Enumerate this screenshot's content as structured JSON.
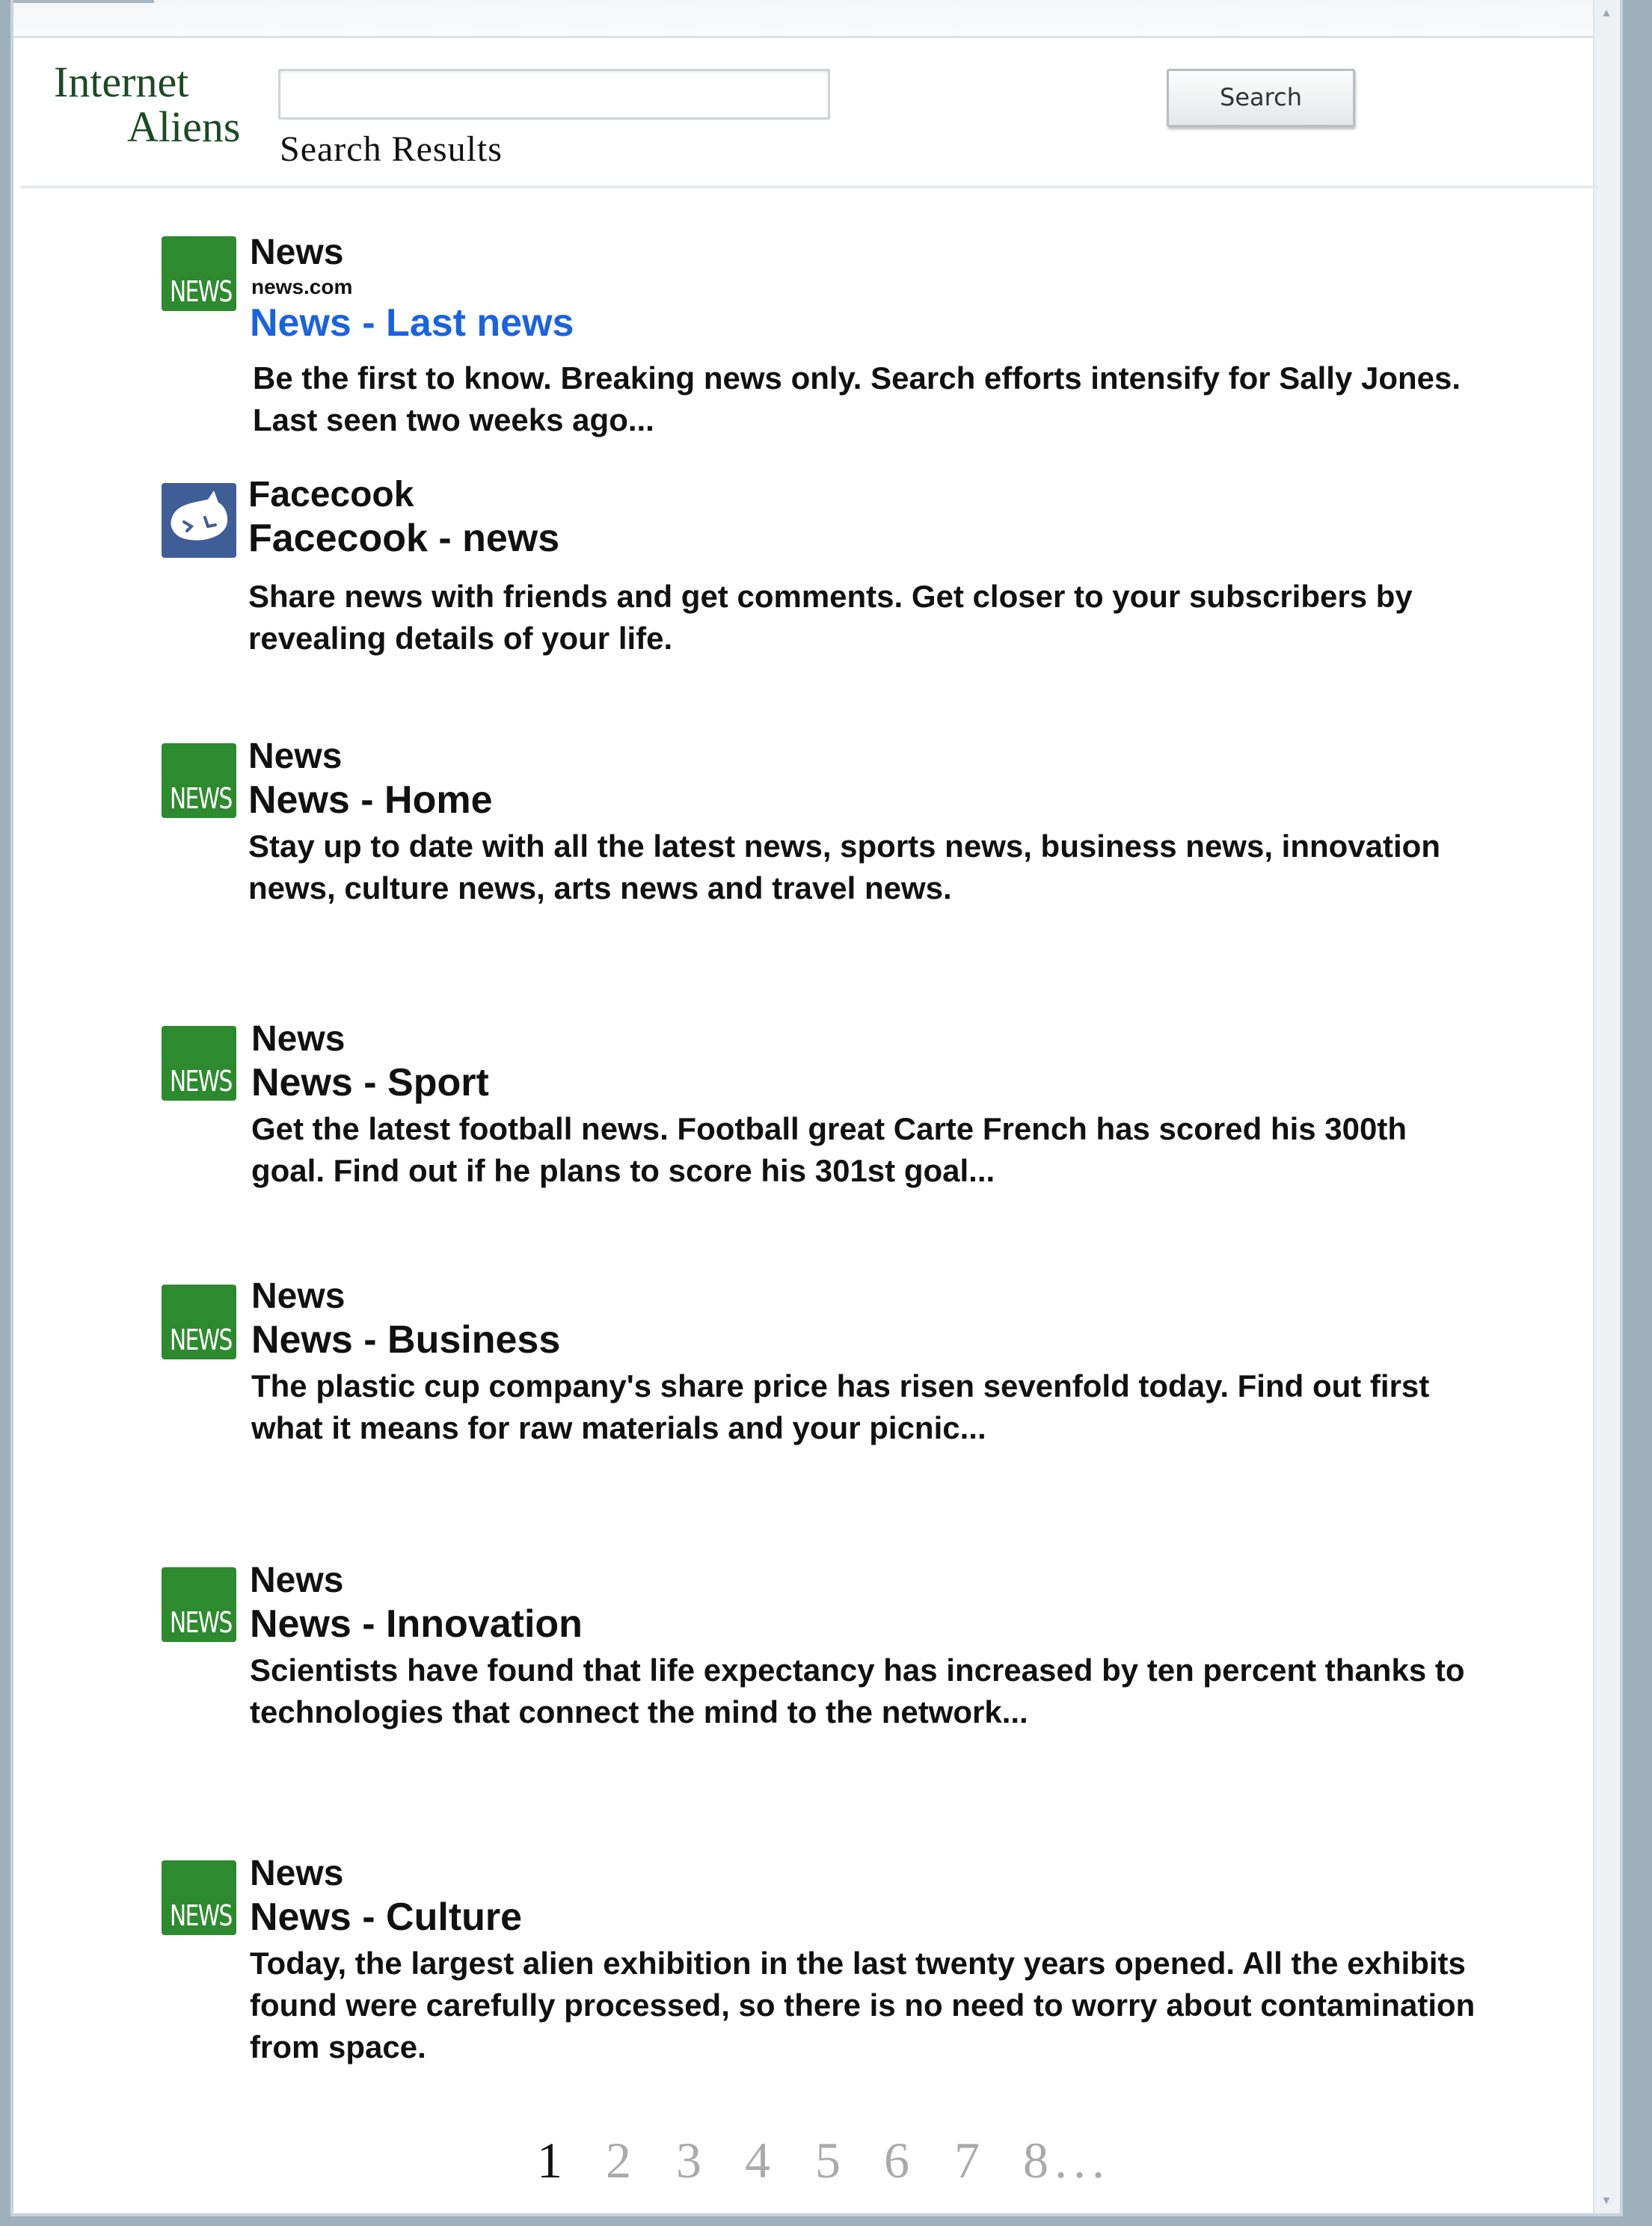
{
  "app": {
    "logo_line1": "Internet",
    "logo_line2": "Aliens"
  },
  "search": {
    "value": "",
    "placeholder": "",
    "button_label": "Search"
  },
  "results_heading": "Search Results",
  "results": [
    {
      "icon": "news-icon",
      "icon_text": "NEWS",
      "site": "News",
      "domain": "news.com",
      "title": "News - Last news",
      "title_is_link": true,
      "snippet_lines": [
        "Be the first to know. Breaking news only. Search efforts intensify for Sally Jones.",
        "Last seen two weeks ago..."
      ]
    },
    {
      "icon": "facecook-icon",
      "icon_text": "",
      "site": "Facecook",
      "domain": "",
      "title": "Facecook - news",
      "title_is_link": false,
      "snippet_lines": [
        "Share news with friends and get comments. Get closer to your subscribers by",
        "revealing details of your life."
      ]
    },
    {
      "icon": "news-icon",
      "icon_text": "NEWS",
      "site": "News",
      "domain": "",
      "title": "News - Home",
      "title_is_link": false,
      "snippet_lines": [
        "Stay up to date with all the latest news, sports news, business news, innovation",
        "news, culture news, arts news and travel news."
      ]
    },
    {
      "icon": "news-icon",
      "icon_text": "NEWS",
      "site": "News",
      "domain": "",
      "title": "News - Sport",
      "title_is_link": false,
      "snippet_lines": [
        "Get the latest football news. Football great Carte French has scored his 300th",
        "goal. Find out if he plans to score his 301st goal..."
      ]
    },
    {
      "icon": "news-icon",
      "icon_text": "NEWS",
      "site": "News",
      "domain": "",
      "title": "News - Business",
      "title_is_link": false,
      "snippet_lines": [
        "The plastic cup company's share price has risen sevenfold today. Find out first",
        "what it means for raw materials and your picnic..."
      ]
    },
    {
      "icon": "news-icon",
      "icon_text": "NEWS",
      "site": "News",
      "domain": "",
      "title": "News - Innovation",
      "title_is_link": false,
      "snippet_lines": [
        "Scientists have found that life expectancy has increased by ten percent thanks to",
        "technologies that connect the mind to the network..."
      ]
    },
    {
      "icon": "news-icon",
      "icon_text": "NEWS",
      "site": "News",
      "domain": "",
      "title": "News - Culture",
      "title_is_link": false,
      "snippet_lines": [
        "Today, the largest alien exhibition in the last twenty years opened. All the exhibits",
        "found were carefully processed, so there is no need to worry about contamination",
        "from space."
      ]
    }
  ],
  "pagination": {
    "pages": [
      "1",
      "2",
      "3",
      "4",
      "5",
      "6",
      "7",
      "8..."
    ],
    "current": "1"
  },
  "colors": {
    "link_blue": "#1a63e0",
    "news_icon_green": "#2e8a2f",
    "facecook_icon_blue": "#3f5d97",
    "logo_green": "#1b4a23"
  }
}
